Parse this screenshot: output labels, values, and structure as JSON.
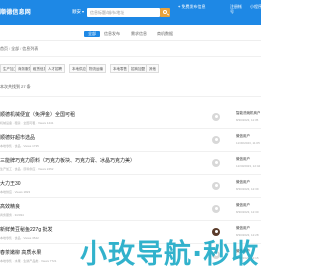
{
  "header": {
    "brand": "顺德信息网",
    "region": "顺安",
    "search_placeholder": "信息标题/城市/地址",
    "publish_label": "免费发布信息",
    "user_link_1": "注册帐号",
    "user_link_2": "小程序"
  },
  "nav": {
    "tabs": [
      "全部",
      "信息发布",
      "需求信息",
      "商机数据"
    ]
  },
  "breadcrumb": [
    "首页",
    "全部",
    "信息列表"
  ],
  "filters": [
    "生产加工",
    "商务服务",
    "租赁信息",
    "人才招聘",
    "本地供应",
    "物流运输",
    "本地零售",
    "招商加盟",
    "其他"
  ],
  "result_count": "本次共找到 27 条",
  "listings": [
    {
      "title": "顺德机械便宜（免押金）全国可租",
      "meta": "机械设备 · 租赁 · 全国可租 · Views 1441",
      "poster": "智能洗碗机商户",
      "date": "8/30/2023, 11:35"
    },
    {
      "title": "顺德好超市选品",
      "meta": "本地零售 · 食品 · Views 1735",
      "poster": "微信用户",
      "date": "11/30/2023, 11:05"
    },
    {
      "title": "三能牌巧克力原料（巧克力板块、巧克力膏、冰晶巧克力美）",
      "meta": "生产加工 · 食品 · 原料供应 · Views 2452",
      "poster": "微信用户",
      "date": "12/30/2023, 12:42"
    },
    {
      "title": "大力王30",
      "meta": "本地供应 · Views 1823",
      "poster": "微信用户",
      "date": "8/30/2023, 12:39"
    },
    {
      "title": "高效精良",
      "meta": "商务服务 · 3/2034",
      "poster": "微信用户",
      "date": "8/30/2023, 12:30"
    },
    {
      "title": "新鲜黄豆秘鱼227g 批发",
      "meta": "本地零售 · 食品 · Views 3542",
      "poster": "微信用户",
      "date": "8/30/2023, 12:28"
    },
    {
      "title": "春茶嫩柳 高质水果",
      "meta": "本地零售 · 水果 · 生鲜产品类 · Views 7721",
      "poster": "微信用户",
      "date": "8/30/2023, 12:15"
    }
  ],
  "watermark": "小玫导航·秒收"
}
